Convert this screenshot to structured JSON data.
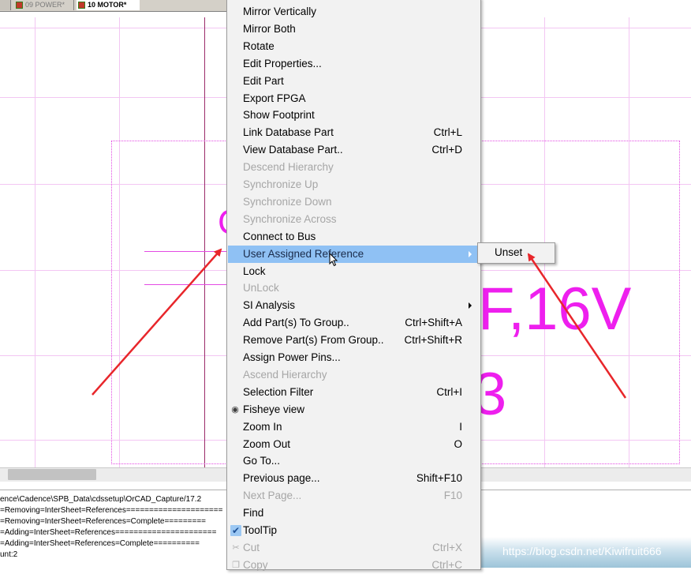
{
  "tabs": [
    {
      "label": ""
    },
    {
      "label": "09 POWER*"
    },
    {
      "label": "10 MOTOR*"
    }
  ],
  "schematic": {
    "text_partial_left": "C",
    "text_value": "F,16V",
    "text_number": "3"
  },
  "context_menu": {
    "items": [
      {
        "label": "Mirror Vertically",
        "shortcut": "",
        "state": "enabled"
      },
      {
        "label": "Mirror Both",
        "shortcut": "",
        "state": "enabled"
      },
      {
        "label": "Rotate",
        "shortcut": "",
        "state": "enabled"
      },
      {
        "label": "Edit Properties...",
        "shortcut": "",
        "state": "enabled"
      },
      {
        "label": "Edit Part",
        "shortcut": "",
        "state": "enabled"
      },
      {
        "label": "Export FPGA",
        "shortcut": "",
        "state": "enabled"
      },
      {
        "label": "Show Footprint",
        "shortcut": "",
        "state": "enabled"
      },
      {
        "label": "Link Database Part",
        "shortcut": "Ctrl+L",
        "state": "enabled"
      },
      {
        "label": "View Database Part..",
        "shortcut": "Ctrl+D",
        "state": "enabled"
      },
      {
        "label": "Descend Hierarchy",
        "shortcut": "",
        "state": "disabled"
      },
      {
        "label": "Synchronize Up",
        "shortcut": "",
        "state": "disabled"
      },
      {
        "label": "Synchronize Down",
        "shortcut": "",
        "state": "disabled"
      },
      {
        "label": "Synchronize Across",
        "shortcut": "",
        "state": "disabled"
      },
      {
        "label": "Connect to Bus",
        "shortcut": "",
        "state": "enabled"
      },
      {
        "label": "User Assigned Reference",
        "shortcut": "",
        "state": "highlighted",
        "submenu": true
      },
      {
        "label": "Lock",
        "shortcut": "",
        "state": "enabled"
      },
      {
        "label": "UnLock",
        "shortcut": "",
        "state": "disabled"
      },
      {
        "label": "SI Analysis",
        "shortcut": "",
        "state": "enabled",
        "submenu": true
      },
      {
        "label": "Add Part(s) To Group..",
        "shortcut": "Ctrl+Shift+A",
        "state": "enabled"
      },
      {
        "label": "Remove Part(s) From Group..",
        "shortcut": "Ctrl+Shift+R",
        "state": "enabled"
      },
      {
        "label": "Assign Power Pins...",
        "shortcut": "",
        "state": "enabled"
      },
      {
        "label": "Ascend Hierarchy",
        "shortcut": "",
        "state": "disabled"
      },
      {
        "label": "Selection Filter",
        "shortcut": "Ctrl+I",
        "state": "enabled"
      },
      {
        "label": "Fisheye view",
        "shortcut": "",
        "state": "enabled",
        "icon": "eye-icon"
      },
      {
        "label": "Zoom In",
        "shortcut": "I",
        "state": "enabled"
      },
      {
        "label": "Zoom Out",
        "shortcut": "O",
        "state": "enabled"
      },
      {
        "label": "Go To...",
        "shortcut": "",
        "state": "enabled"
      },
      {
        "label": "Previous page...",
        "shortcut": "Shift+F10",
        "state": "enabled"
      },
      {
        "label": "Next Page...",
        "shortcut": "F10",
        "state": "disabled"
      },
      {
        "label": "Find",
        "shortcut": "",
        "state": "enabled"
      },
      {
        "label": "ToolTip",
        "shortcut": "",
        "state": "enabled",
        "checked": true
      },
      {
        "label": "Cut",
        "shortcut": "Ctrl+X",
        "state": "disabled",
        "icon": "scissors-icon"
      },
      {
        "label": "Copy",
        "shortcut": "Ctrl+C",
        "state": "disabled",
        "icon": "copy-icon"
      }
    ]
  },
  "submenu": {
    "items": [
      {
        "label": "Unset"
      }
    ]
  },
  "output_log": {
    "lines": [
      "ence\\Cadence\\SPB_Data\\cdssetup\\OrCAD_Capture/17.2",
      "=Removing=InterSheet=References=====================",
      "=Removing=InterSheet=References=Complete=========",
      "=Adding=InterSheet=References======================",
      "=Adding=InterSheet=References=Complete==========",
      "unt:2"
    ]
  },
  "watermark": "https://blog.csdn.net/Kiwifruit666",
  "colors": {
    "grid": "#f3c6f3",
    "schematic_text": "#ee1fee",
    "highlight": "#8fc1f4",
    "annotation_arrow": "#e8262b"
  }
}
